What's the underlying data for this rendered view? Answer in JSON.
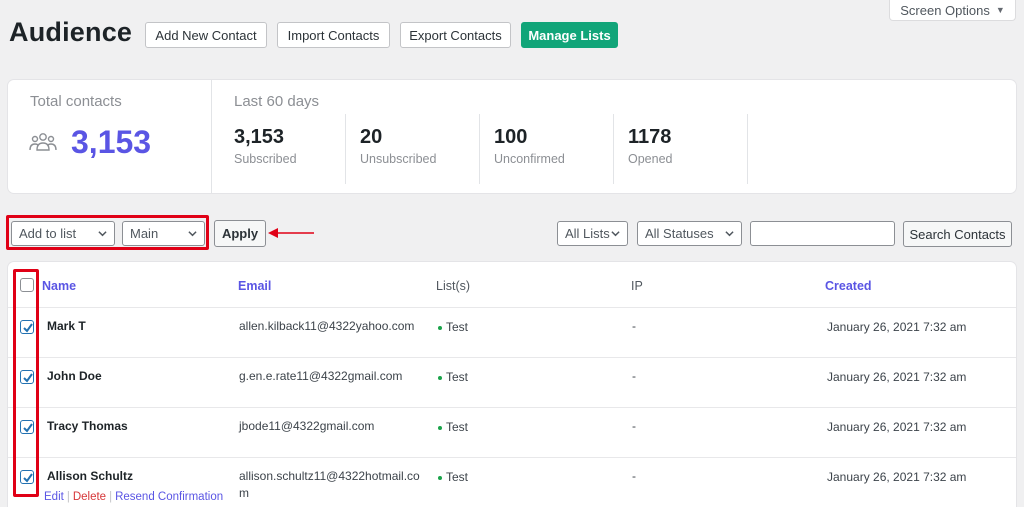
{
  "screen_options": {
    "label": "Screen Options",
    "caret": "▼"
  },
  "header": {
    "title": "Audience",
    "buttons": {
      "add_new": "Add New Contact",
      "import": "Import Contacts",
      "export": "Export Contacts",
      "manage": "Manage Lists"
    }
  },
  "stats": {
    "total_label": "Total contacts",
    "total_value": "3,153",
    "period_label": "Last 60 days",
    "cells": [
      {
        "value": "3,153",
        "label": "Subscribed"
      },
      {
        "value": "20",
        "label": "Unsubscribed"
      },
      {
        "value": "100",
        "label": "Unconfirmed"
      },
      {
        "value": "1178",
        "label": "Opened"
      }
    ]
  },
  "toolbar": {
    "bulk_action": "Add to list",
    "list_select": "Main",
    "apply": "Apply",
    "filter_lists": "All Lists",
    "filter_statuses": "All Statuses",
    "search_value": "",
    "search_button": "Search Contacts"
  },
  "table": {
    "columns": {
      "name": "Name",
      "email": "Email",
      "lists": "List(s)",
      "ip": "IP",
      "created": "Created"
    },
    "rows": [
      {
        "name": "Mark T",
        "email": "allen.kilback11@4322yahoo.com",
        "list": "Test",
        "ip": "-",
        "created": "January 26, 2021 7:32 am"
      },
      {
        "name": "John Doe",
        "email": "g.en.e.rate11@4322gmail.com",
        "list": "Test",
        "ip": "-",
        "created": "January 26, 2021 7:32 am"
      },
      {
        "name": "Tracy Thomas",
        "email": "jbode11@4322gmail.com",
        "list": "Test",
        "ip": "-",
        "created": "January 26, 2021 7:32 am"
      },
      {
        "name": "Allison Schultz",
        "email": "allison.schultz11@4322hotmail.co",
        "email_wrap": "m",
        "list": "Test",
        "ip": "-",
        "created": "January 26, 2021 7:32 am"
      }
    ],
    "row_actions": {
      "edit": "Edit",
      "delete": "Delete",
      "resend": "Resend Confirmation"
    }
  },
  "colors": {
    "accent": "#5a55e4",
    "primary_button": "#11a579",
    "highlight": "#e00016",
    "checkbox": "#2271b1"
  }
}
